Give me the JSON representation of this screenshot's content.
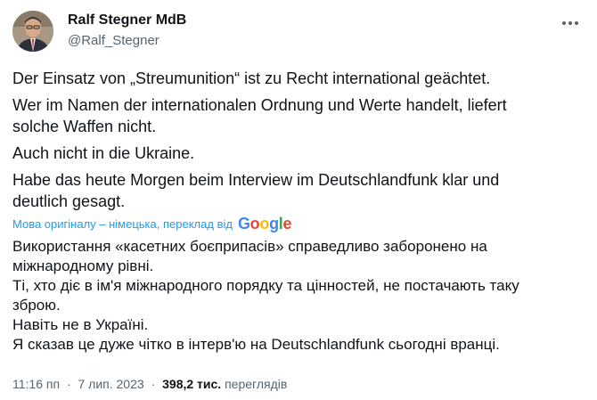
{
  "author": {
    "display_name": "Ralf Stegner MdB",
    "handle": "@Ralf_Stegner"
  },
  "tweet": {
    "original_lines": [
      "Der Einsatz von „Streumunition“ ist zu Recht international geächtet.",
      "Wer im Namen der internationalen Ordnung und Werte handelt, liefert",
      "solche Waffen nicht.",
      "Auch nicht in die Ukraine.",
      "Habe das heute Morgen beim Interview im Deutschlandfunk klar und",
      "deutlich gesagt."
    ],
    "translation_notice": "Мова оригіналу – німецька, переклад від",
    "translation_provider": "Google",
    "translated_lines": [
      "Використання «касетних боєприпасів» справедливо заборонено на",
      "міжнародному рівні.",
      "Ті, хто діє в ім'я міжнародного порядку та цінностей, не постачають таку",
      "зброю.",
      "Навіть не в Україні.",
      "Я сказав це дуже чітко в інтерв'ю на Deutschlandfunk сьогодні вранці."
    ]
  },
  "meta": {
    "time": "11:16 пп",
    "separator": "·",
    "date": "7 лип. 2023",
    "views_count": "398,2 тис.",
    "views_label": "переглядів"
  },
  "icons": {
    "more": "more-horizontal-icon",
    "google": "google-logo"
  },
  "colors": {
    "text": "#0f1419",
    "secondary": "#536471",
    "link": "#1d9bf0"
  }
}
